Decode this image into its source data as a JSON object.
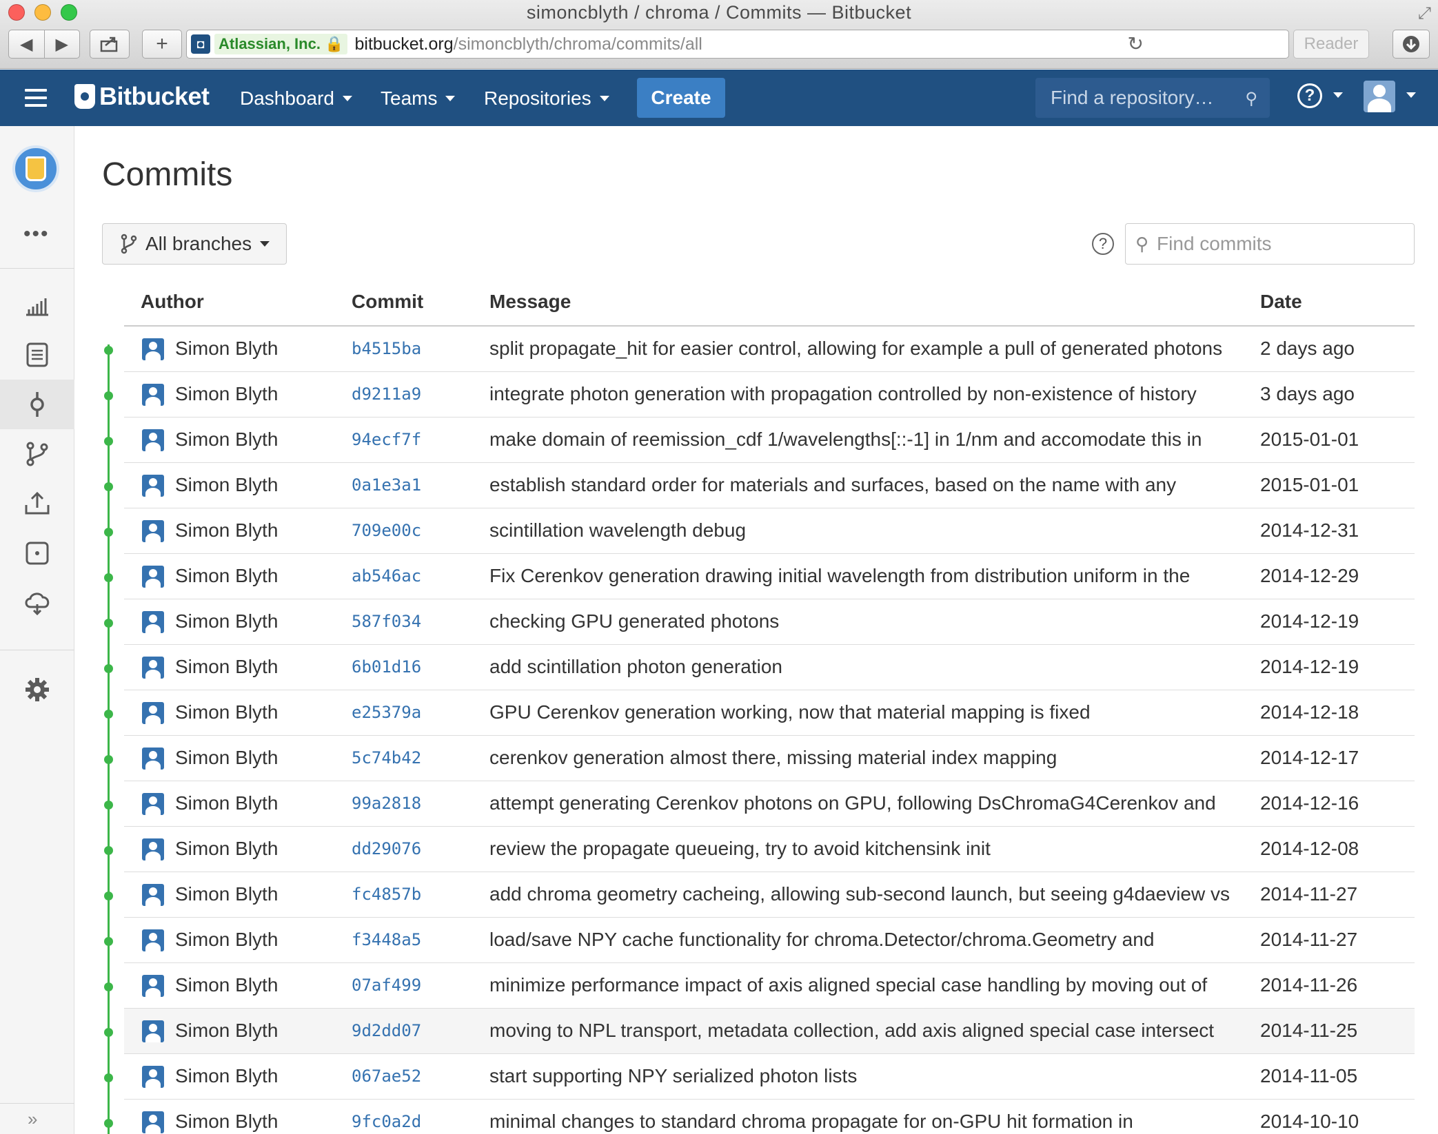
{
  "window": {
    "title": "simoncblyth / chroma / Commits — Bitbucket",
    "reader_label": "Reader"
  },
  "addressbar": {
    "ev_badge": "Atlassian, Inc.",
    "url_host": "bitbucket.org",
    "url_path": "/simoncblyth/chroma/commits/all"
  },
  "header": {
    "logo_text": "Bitbucket",
    "nav": [
      "Dashboard",
      "Teams",
      "Repositories"
    ],
    "create_label": "Create",
    "search_placeholder": "Find a repository…",
    "accent_color": "#205081"
  },
  "page": {
    "title": "Commits",
    "branch_filter": "All branches",
    "find_placeholder": "Find commits"
  },
  "table": {
    "headers": {
      "author": "Author",
      "commit": "Commit",
      "message": "Message",
      "date": "Date"
    },
    "rows": [
      {
        "author": "Simon Blyth",
        "hash": "b4515ba",
        "message": "split propagate_hit for easier control, allowing for example a pull of generated photons",
        "date": "2 days ago"
      },
      {
        "author": "Simon Blyth",
        "hash": "d9211a9",
        "message": "integrate photon generation with propagation controlled by non-existence of history",
        "date": "3 days ago"
      },
      {
        "author": "Simon Blyth",
        "hash": "94ecf7f",
        "message": "make domain of reemission_cdf 1/wavelengths[::-1] in 1/nm and accomodate this in",
        "date": "2015-01-01"
      },
      {
        "author": "Simon Blyth",
        "hash": "0a1e3a1",
        "message": "establish standard order for materials and surfaces, based on the name with any",
        "date": "2015-01-01"
      },
      {
        "author": "Simon Blyth",
        "hash": "709e00c",
        "message": "scintillation wavelength debug",
        "date": "2014-12-31"
      },
      {
        "author": "Simon Blyth",
        "hash": "ab546ac",
        "message": "Fix Cerenkov generation drawing initial wavelength from distribution uniform in the",
        "date": "2014-12-29"
      },
      {
        "author": "Simon Blyth",
        "hash": "587f034",
        "message": "checking GPU generated photons",
        "date": "2014-12-19"
      },
      {
        "author": "Simon Blyth",
        "hash": "6b01d16",
        "message": "add scintillation photon generation",
        "date": "2014-12-19"
      },
      {
        "author": "Simon Blyth",
        "hash": "e25379a",
        "message": "GPU Cerenkov generation working, now that material mapping is fixed",
        "date": "2014-12-18"
      },
      {
        "author": "Simon Blyth",
        "hash": "5c74b42",
        "message": "cerenkov generation almost there, missing material index mapping",
        "date": "2014-12-17"
      },
      {
        "author": "Simon Blyth",
        "hash": "99a2818",
        "message": "attempt generating Cerenkov photons on GPU, following DsChromaG4Cerenkov and",
        "date": "2014-12-16"
      },
      {
        "author": "Simon Blyth",
        "hash": "dd29076",
        "message": "review the propagate queueing, try to avoid kitchensink init",
        "date": "2014-12-08"
      },
      {
        "author": "Simon Blyth",
        "hash": "fc4857b",
        "message": "add chroma geometry cacheing, allowing sub-second launch, but seeing g4daeview vs",
        "date": "2014-11-27"
      },
      {
        "author": "Simon Blyth",
        "hash": "f3448a5",
        "message": "load/save NPY cache functionality for chroma.Detector/chroma.Geometry and",
        "date": "2014-11-27"
      },
      {
        "author": "Simon Blyth",
        "hash": "07af499",
        "message": "minimize performance impact of axis aligned special case handling by moving out of",
        "date": "2014-11-26"
      },
      {
        "author": "Simon Blyth",
        "hash": "9d2dd07",
        "message": "moving to NPL transport, metadata collection, add axis aligned special case intersect",
        "date": "2014-11-25"
      },
      {
        "author": "Simon Blyth",
        "hash": "067ae52",
        "message": "start supporting NPY serialized photon lists",
        "date": "2014-11-05"
      },
      {
        "author": "Simon Blyth",
        "hash": "9fc0a2d",
        "message": "minimal changes to standard chroma propagate for on-GPU hit formation in",
        "date": "2014-10-10"
      }
    ]
  }
}
